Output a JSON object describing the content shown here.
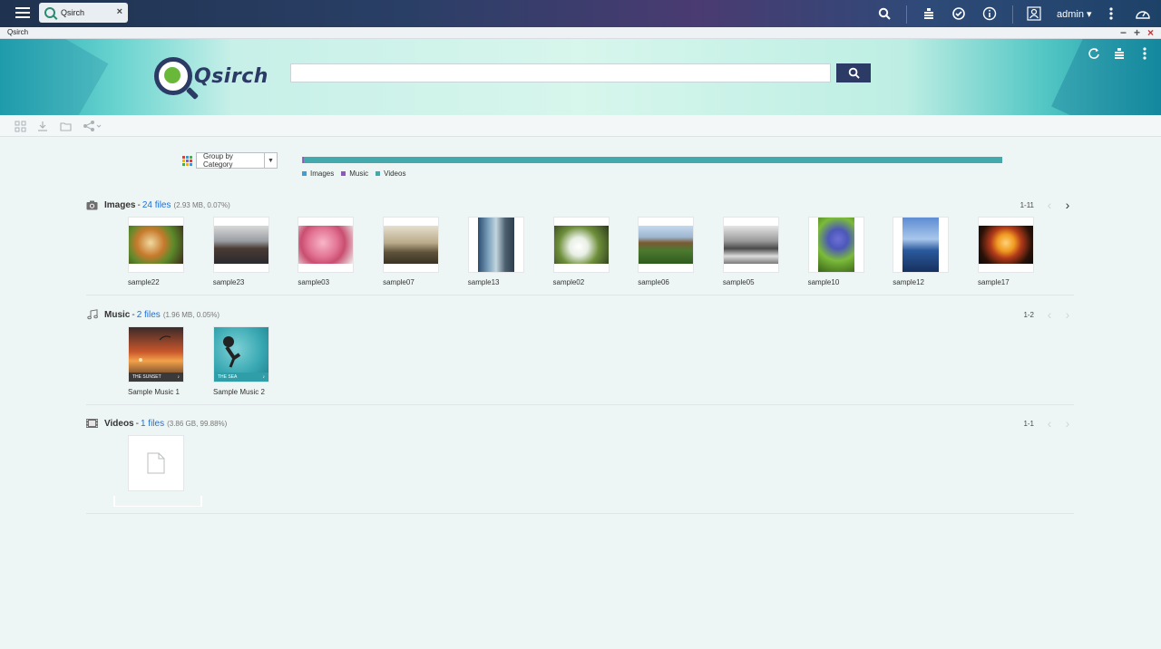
{
  "topbar": {
    "tab_label": "Qsirch",
    "tab_close": "×",
    "user": "admin ▾"
  },
  "apptitle": {
    "name": "Qsirch",
    "minimize": "−",
    "maximize": "+",
    "close": "×"
  },
  "header": {
    "logo_text": "Qsirch",
    "search_value": "",
    "search_placeholder": ""
  },
  "group": {
    "selected": "Group by Category"
  },
  "usage": {
    "legend": [
      {
        "label": "Images",
        "color": "#3e9fd8"
      },
      {
        "label": "Music",
        "color": "#8a5bb8"
      },
      {
        "label": "Videos",
        "color": "#43a9ad"
      }
    ],
    "fractions": {
      "images": 0.0007,
      "music": 0.0005,
      "videos": 0.9988
    }
  },
  "sections": {
    "images": {
      "title": "Images",
      "count_link": "24 files",
      "meta": "(2.93 MB, 0.07%)",
      "range": "1-11",
      "items": [
        "sample22",
        "sample23",
        "sample03",
        "sample07",
        "sample13",
        "sample02",
        "sample06",
        "sample05",
        "sample10",
        "sample12",
        "sample17"
      ]
    },
    "music": {
      "title": "Music",
      "count_link": "2 files",
      "meta": "(1.96 MB, 0.05%)",
      "range": "1-2",
      "items": [
        {
          "label": "Sample Music 1",
          "caption": "THE SUNSET"
        },
        {
          "label": "Sample Music 2",
          "caption": "THE SEA"
        }
      ]
    },
    "videos": {
      "title": "Videos",
      "count_link": "1 files",
      "meta": "(3.86 GB, 99.88%)",
      "range": "1-1"
    }
  },
  "colors": {
    "accent": "#2c3a66",
    "link": "#1e6fd9",
    "usage_bar": "#43a9ad"
  }
}
